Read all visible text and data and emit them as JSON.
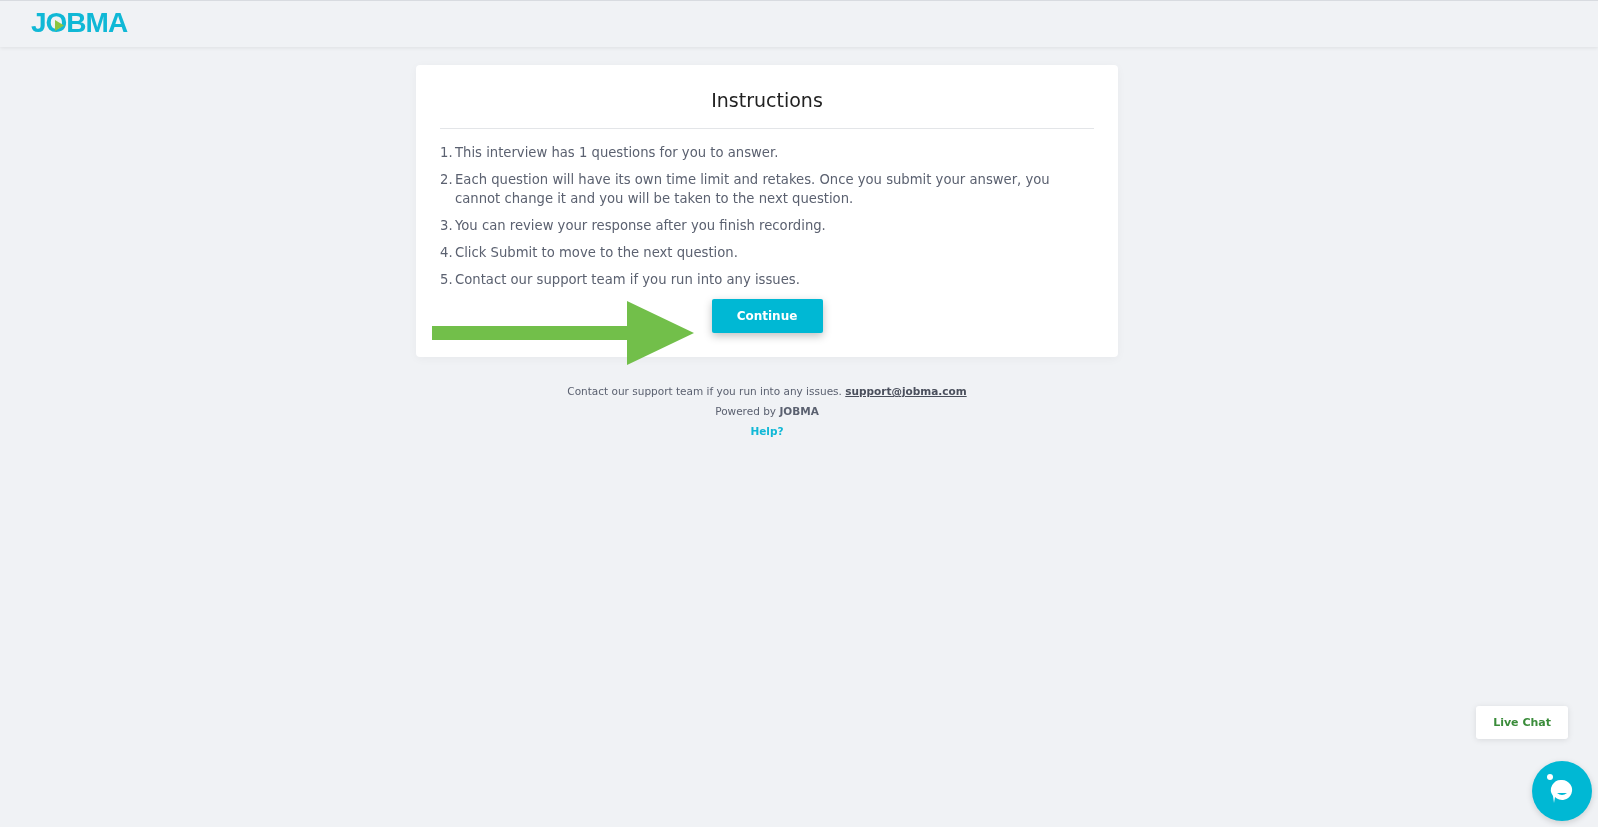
{
  "header": {
    "logo": "JOBMA"
  },
  "card": {
    "title": "Instructions",
    "steps": [
      {
        "number": "1.",
        "text": "This interview has 1 questions for you to answer."
      },
      {
        "number": "2.",
        "text": "Each question will have its own time limit and retakes. Once you submit your answer, you cannot change it and you will be taken to the next question."
      },
      {
        "number": "3.",
        "text": "You can review your response after you finish recording."
      },
      {
        "number": "4.",
        "text": "Click Submit to move to the next question."
      },
      {
        "number": "5.",
        "text": "Contact our support team if you run into any issues."
      }
    ],
    "button": "Continue"
  },
  "footer": {
    "contact": "Contact our support team if you run into any issues.",
    "email": "support@jobma.com",
    "powered": "Powered by **JOBMA**",
    "help": "Help?"
  },
  "chat": {
    "label": "Live Chat"
  }
}
